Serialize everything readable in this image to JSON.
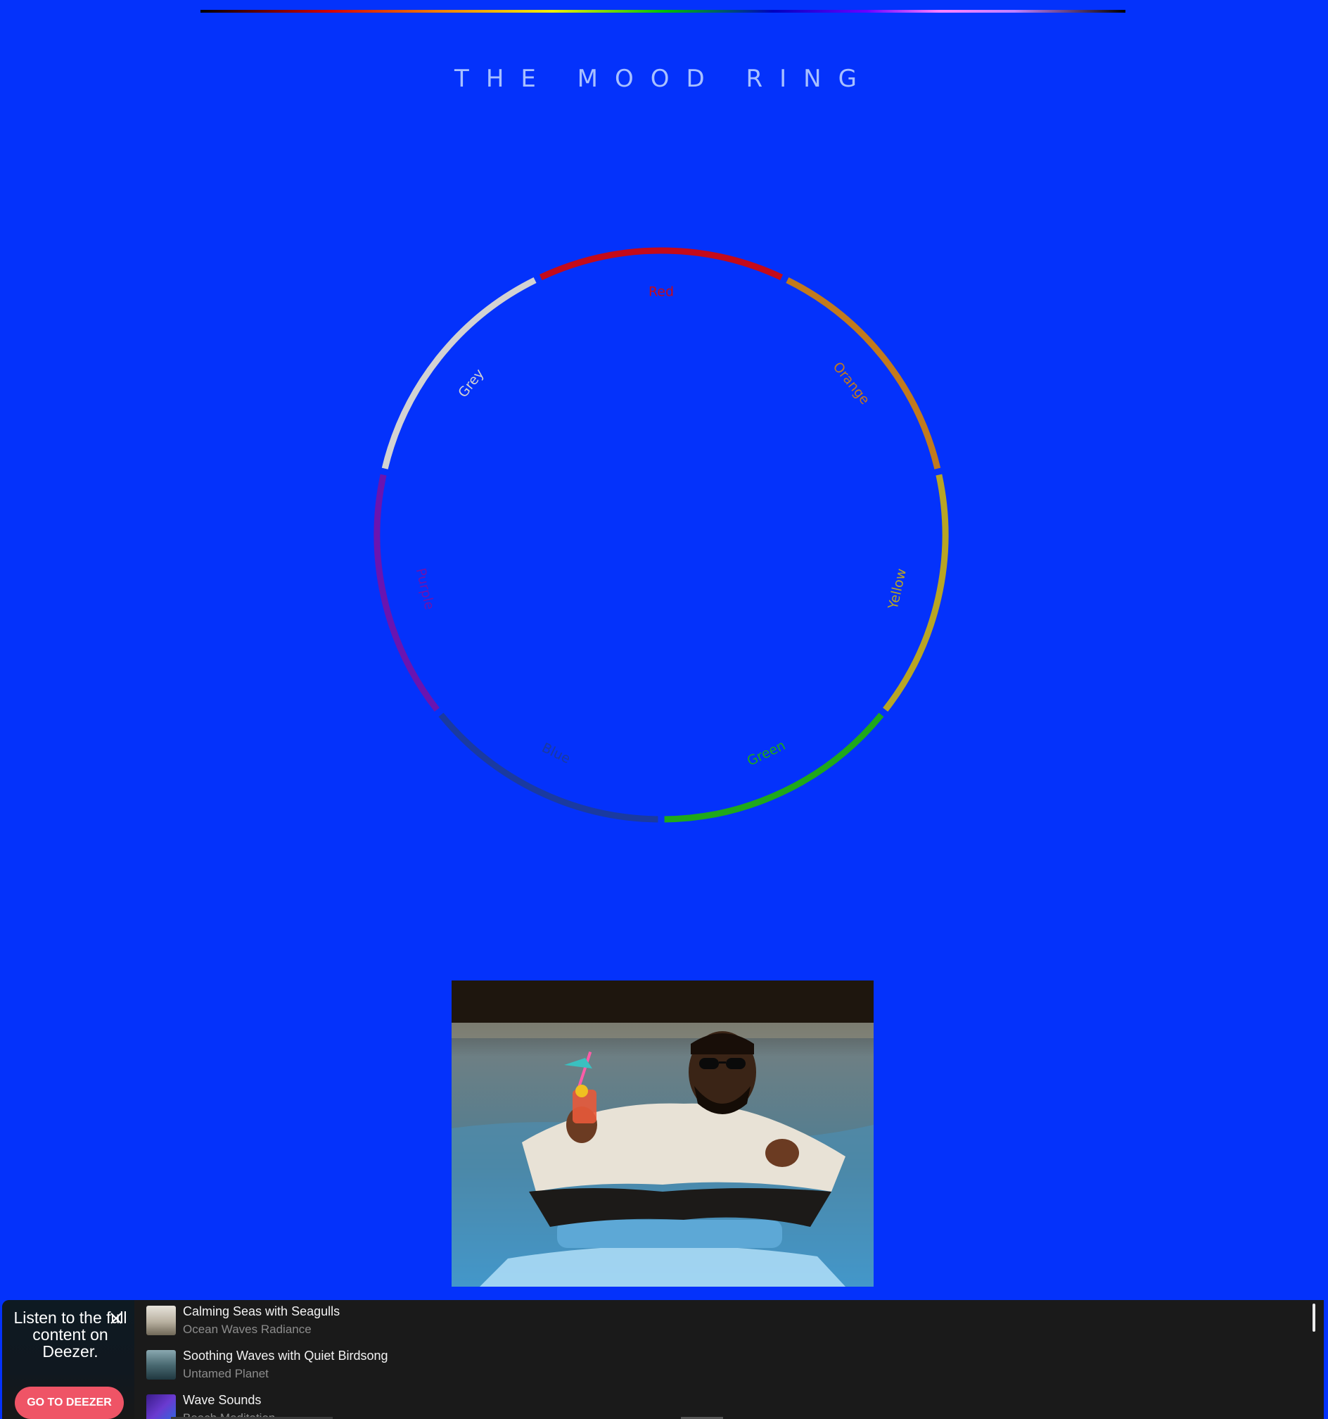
{
  "header": {
    "title": "THE MOOD RING"
  },
  "ring": {
    "segments": [
      {
        "name": "Red",
        "color": "#c40a1a"
      },
      {
        "name": "Orange",
        "color": "#c27a1c"
      },
      {
        "name": "Yellow",
        "color": "#b8a524"
      },
      {
        "name": "Green",
        "color": "#1fa81a"
      },
      {
        "name": "Blue",
        "color": "#1a3aa0"
      },
      {
        "name": "Purple",
        "color": "#6a14b0"
      },
      {
        "name": "Grey",
        "color": "#d2d2d2"
      }
    ]
  },
  "player": {
    "promo": {
      "text": "Listen to the full content on Deezer.",
      "button_label": "GO TO DEEZER"
    },
    "tracks": [
      {
        "title": "Calming Seas with Seagulls",
        "artist": "Ocean Waves Radiance"
      },
      {
        "title": "Soothing Waves with Quiet Birdsong",
        "artist": "Untamed Planet"
      },
      {
        "title": "Wave Sounds",
        "artist": "Beach Meditation"
      }
    ]
  }
}
